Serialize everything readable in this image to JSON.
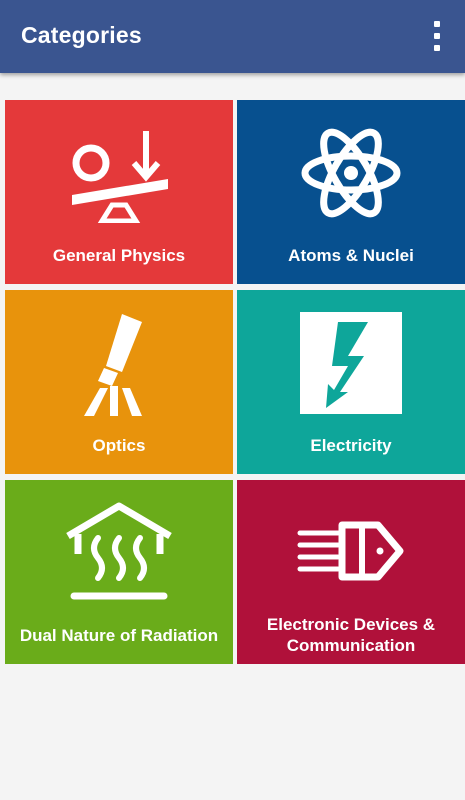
{
  "app_bar": {
    "title": "Categories",
    "overflow_icon": "more-vert-icon",
    "color": "#3a5590"
  },
  "categories": [
    {
      "label": "General Physics",
      "color": "#e4393a",
      "icon": "balance-seesaw-icon"
    },
    {
      "label": "Atoms & Nuclei",
      "color": "#07508f",
      "icon": "atom-icon"
    },
    {
      "label": "Optics",
      "color": "#e8930c",
      "icon": "telescope-icon"
    },
    {
      "label": "Electricity",
      "color": "#0ea69a",
      "icon": "lightning-bolt-icon"
    },
    {
      "label": "Dual Nature of Radiation",
      "color": "#6aac1a",
      "icon": "heat-radiation-icon"
    },
    {
      "label": "Electronic Devices & Communication",
      "color": "#b0113a",
      "icon": "diode-device-icon"
    }
  ]
}
